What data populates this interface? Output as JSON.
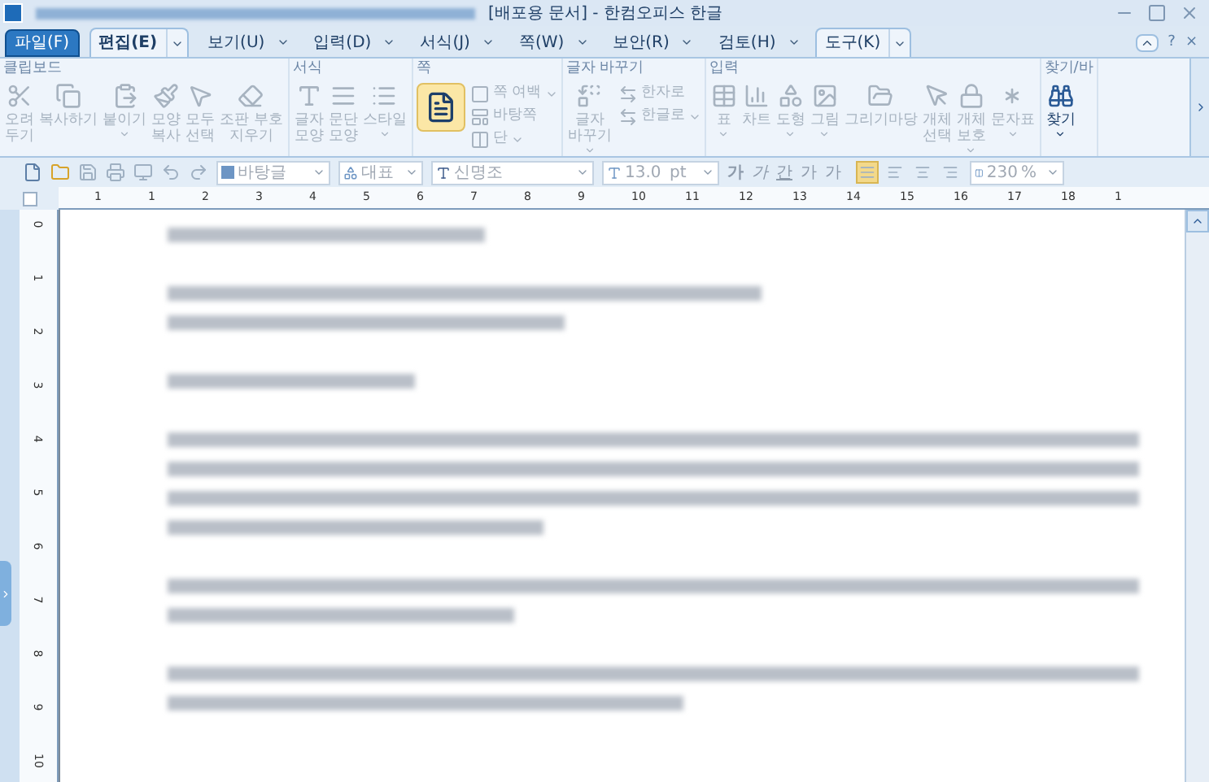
{
  "title_bar": {
    "title": "[배포용 문서] - 한컴오피스 한글"
  },
  "menu_tabs": [
    {
      "label": "파일(F)",
      "kind": "file",
      "selected": false,
      "boxed": false
    },
    {
      "label": "편집(E)",
      "kind": "tab",
      "selected": true,
      "boxed": true
    },
    {
      "label": "보기(U)",
      "kind": "tab",
      "selected": false,
      "boxed": false
    },
    {
      "label": "입력(D)",
      "kind": "tab",
      "selected": false,
      "boxed": false
    },
    {
      "label": "서식(J)",
      "kind": "tab",
      "selected": false,
      "boxed": false
    },
    {
      "label": "쪽(W)",
      "kind": "tab",
      "selected": false,
      "boxed": false
    },
    {
      "label": "보안(R)",
      "kind": "tab",
      "selected": false,
      "boxed": false
    },
    {
      "label": "검토(H)",
      "kind": "tab",
      "selected": false,
      "boxed": false
    },
    {
      "label": "도구(K)",
      "kind": "tab",
      "selected": false,
      "boxed": true
    }
  ],
  "help_buttons": [
    "?",
    "×"
  ],
  "ribbon_groups": [
    {
      "title": "클립보드",
      "items": [
        {
          "kind": "large",
          "lines": [
            "오려",
            "두기"
          ],
          "disabled": true,
          "active": false,
          "dropdown": false
        },
        {
          "kind": "large",
          "lines": [
            "복사하기"
          ],
          "disabled": true,
          "active": false,
          "dropdown": false
        },
        {
          "kind": "large",
          "lines": [
            "붙이기"
          ],
          "disabled": true,
          "active": false,
          "dropdown": true
        },
        {
          "kind": "large",
          "lines": [
            "모양",
            "복사"
          ],
          "disabled": true,
          "active": false,
          "dropdown": false
        },
        {
          "kind": "large",
          "lines": [
            "모두",
            "선택"
          ],
          "disabled": true,
          "active": false,
          "dropdown": false
        },
        {
          "kind": "large",
          "lines": [
            "조판 부호",
            "지우기"
          ],
          "disabled": true,
          "active": false,
          "dropdown": false
        }
      ]
    },
    {
      "title": "서식",
      "items": [
        {
          "kind": "large",
          "lines": [
            "글자",
            "모양"
          ],
          "disabled": true,
          "active": false,
          "dropdown": false
        },
        {
          "kind": "large",
          "lines": [
            "문단",
            "모양"
          ],
          "disabled": true,
          "active": false,
          "dropdown": false
        },
        {
          "kind": "large",
          "lines": [
            "스타일"
          ],
          "disabled": true,
          "active": false,
          "dropdown": true
        }
      ]
    },
    {
      "title": "쪽",
      "items": [
        {
          "kind": "icon",
          "disabled": false,
          "active": true
        },
        {
          "kind": "small",
          "lines": [
            "쪽 여백"
          ],
          "disabled": true,
          "active": false,
          "dropdown": true
        },
        {
          "kind": "small",
          "lines": [
            "바탕쪽"
          ],
          "disabled": true,
          "active": false,
          "dropdown": false
        },
        {
          "kind": "small",
          "lines": [
            "단"
          ],
          "disabled": true,
          "active": false,
          "dropdown": true
        }
      ]
    },
    {
      "title": "글자 바꾸기",
      "items": [
        {
          "kind": "large",
          "lines": [
            "글자",
            "바꾸기"
          ],
          "disabled": true,
          "active": false,
          "dropdown": true
        },
        {
          "kind": "small",
          "lines": [
            "한자로"
          ],
          "disabled": true,
          "active": false,
          "dropdown": false
        },
        {
          "kind": "small",
          "lines": [
            "한글로"
          ],
          "disabled": true,
          "active": false,
          "dropdown": true
        }
      ]
    },
    {
      "title": "입력",
      "items": [
        {
          "kind": "large",
          "lines": [
            "표"
          ],
          "disabled": true,
          "active": false,
          "dropdown": true
        },
        {
          "kind": "large",
          "lines": [
            "차트"
          ],
          "disabled": true,
          "active": false,
          "dropdown": false
        },
        {
          "kind": "large",
          "lines": [
            "도형"
          ],
          "disabled": true,
          "active": false,
          "dropdown": true
        },
        {
          "kind": "large",
          "lines": [
            "그림"
          ],
          "disabled": true,
          "active": false,
          "dropdown": true
        },
        {
          "kind": "large",
          "lines": [
            "그리기마당"
          ],
          "disabled": true,
          "active": false,
          "dropdown": false
        },
        {
          "kind": "large",
          "lines": [
            "개체",
            "선택"
          ],
          "disabled": true,
          "active": false,
          "dropdown": false
        },
        {
          "kind": "large",
          "lines": [
            "개체",
            "보호"
          ],
          "disabled": true,
          "active": false,
          "dropdown": true
        },
        {
          "kind": "large",
          "lines": [
            "문자표"
          ],
          "disabled": true,
          "active": false,
          "dropdown": true
        }
      ]
    },
    {
      "title": "찾기/바",
      "items": [
        {
          "kind": "large",
          "lines": [
            "찾기"
          ],
          "disabled": false,
          "active": false,
          "dropdown": true
        }
      ]
    }
  ],
  "toolbar": {
    "style": "바탕글",
    "outline": "대표",
    "font": "신명조",
    "size": "13.0",
    "size_unit": "pt",
    "char_buttons": [
      "가",
      "가",
      "간",
      "가",
      "가"
    ],
    "align_buttons": [
      {
        "selected": true
      },
      {
        "selected": false
      },
      {
        "selected": false
      },
      {
        "selected": false
      }
    ],
    "zoom": "230",
    "zoom_unit": "%"
  },
  "ruler": {
    "labels": [
      "1",
      "1",
      "2",
      "3",
      "4",
      "5",
      "6",
      "7",
      "8",
      "9",
      "10",
      "11",
      "12",
      "13",
      "14",
      "15",
      "16",
      "17",
      "18",
      "1"
    ]
  },
  "vertical_ruler": {
    "labels": [
      "0",
      "1",
      "2",
      "3",
      "4",
      "5",
      "6",
      "7",
      "8",
      "9",
      "10"
    ]
  }
}
